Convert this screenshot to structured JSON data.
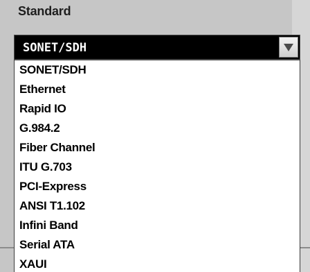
{
  "field": {
    "label": "Standard"
  },
  "select": {
    "value": "SONET/SDH",
    "arrow_icon": "triangle-down-icon"
  },
  "options": [
    "SONET/SDH",
    "Ethernet",
    "Rapid IO",
    "G.984.2",
    "Fiber Channel",
    "ITU G.703",
    "PCI-Express",
    "ANSI T1.102",
    "Infini Band",
    "Serial ATA",
    "XAUI"
  ],
  "colors": {
    "panel_background": "#c6c6c6",
    "select_background": "#000000",
    "select_text": "#ffffff",
    "list_background": "#ffffff",
    "list_text": "#000000"
  }
}
